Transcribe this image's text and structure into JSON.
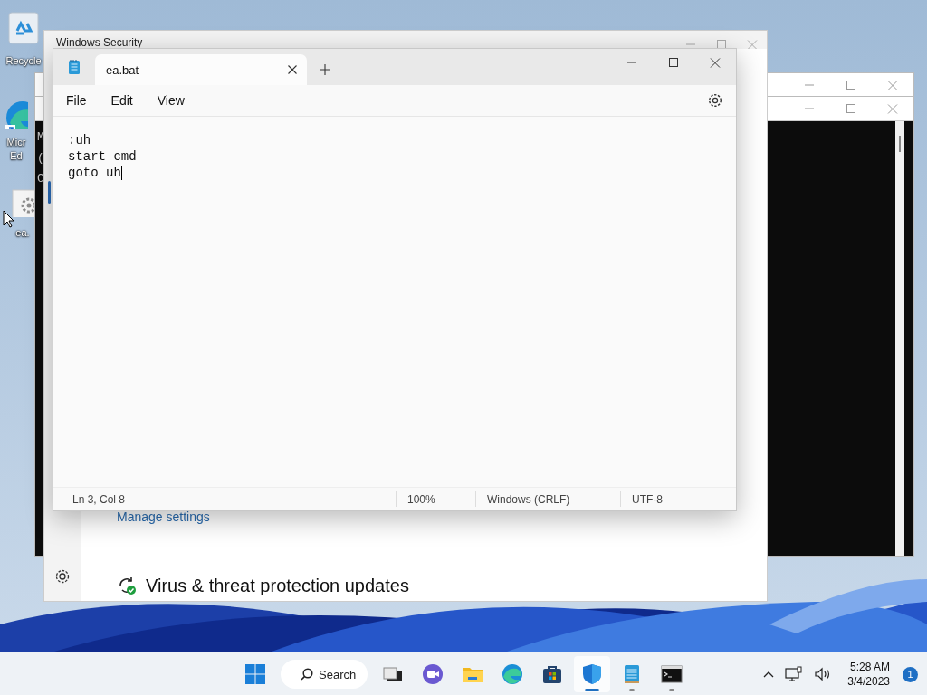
{
  "desktop": {
    "icons": [
      {
        "kind": "recycle",
        "label_lines": [
          "Recycle"
        ]
      },
      {
        "kind": "edge",
        "label_lines": [
          "Micr",
          "Ed"
        ]
      },
      {
        "kind": "file",
        "label_lines": [
          "ea."
        ]
      }
    ]
  },
  "console_windows": [
    {
      "kind": "title_only"
    },
    {
      "kind": "full",
      "visible_text": [
        "M",
        "(",
        "C"
      ]
    }
  ],
  "security_window": {
    "title": "Windows Security",
    "link": "Manage settings",
    "section_heading": "Virus & threat protection updates"
  },
  "notepad": {
    "tabs": [
      {
        "label": "ea.bat",
        "selected": true
      }
    ],
    "menu": [
      "File",
      "Edit",
      "View"
    ],
    "lines": [
      {
        "text": ":uh",
        "caret": false
      },
      {
        "text": "start cmd",
        "caret": false
      },
      {
        "text": "goto uh",
        "caret": true
      }
    ],
    "status_bar": [
      "Ln 3, Col 8",
      "100%",
      "Windows (CRLF)",
      "UTF-8"
    ]
  },
  "taskbar": {
    "search": {
      "label": "Search"
    },
    "apps": [
      {
        "kind": "taskview",
        "active": false,
        "running": false
      },
      {
        "kind": "chat",
        "active": false,
        "running": false
      },
      {
        "kind": "explorer",
        "active": false,
        "running": false
      },
      {
        "kind": "edge",
        "active": false,
        "running": false
      },
      {
        "kind": "store",
        "active": false,
        "running": false
      },
      {
        "kind": "security",
        "active": true,
        "running": true
      },
      {
        "kind": "notepad",
        "active": false,
        "running": true
      },
      {
        "kind": "terminal",
        "active": false,
        "running": true
      }
    ],
    "clock": {
      "time": "5:28 AM",
      "date": "3/4/2023"
    },
    "notification_count": "1"
  }
}
